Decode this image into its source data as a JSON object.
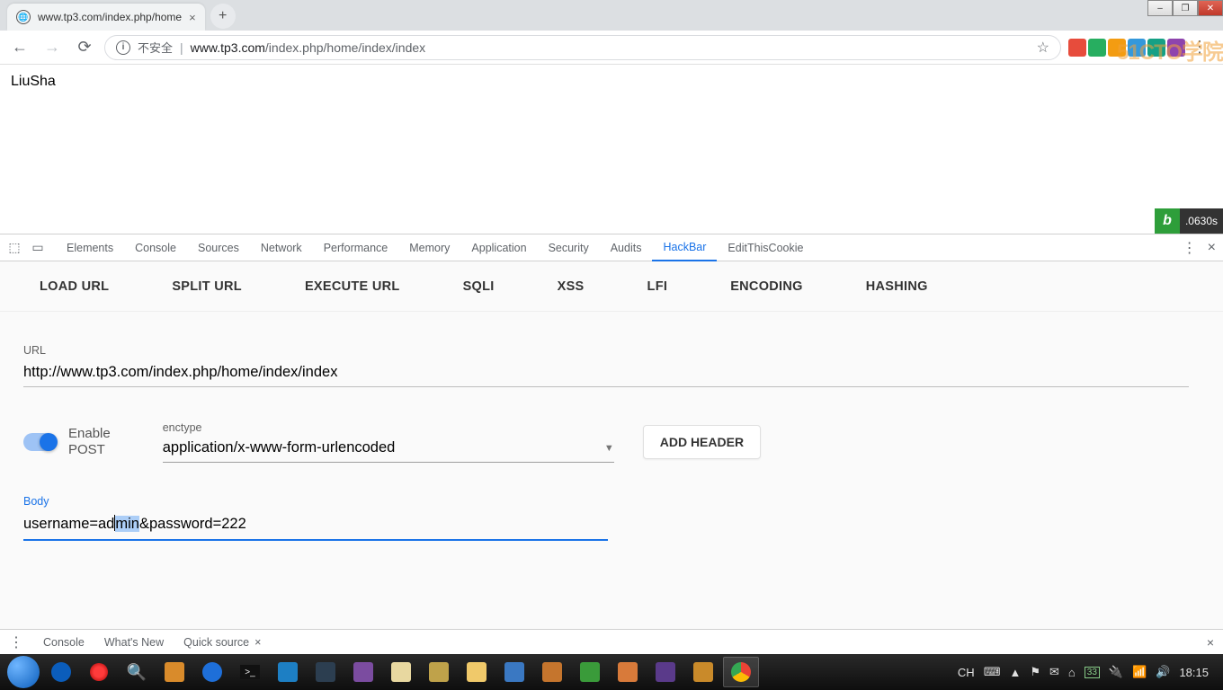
{
  "window": {
    "minimize": "–",
    "maximize": "❐",
    "close": "✕"
  },
  "tab": {
    "title": "www.tp3.com/index.php/home"
  },
  "omnibox": {
    "insecure_label": "不安全",
    "host": "www.tp3.com",
    "path": "/index.php/home/index/index"
  },
  "page": {
    "content": "LiuSha"
  },
  "tp_badge": {
    "logo": "b",
    "time": ".0630s"
  },
  "devtools": {
    "tabs": [
      "Elements",
      "Console",
      "Sources",
      "Network",
      "Performance",
      "Memory",
      "Application",
      "Security",
      "Audits",
      "HackBar",
      "EditThisCookie"
    ],
    "active_tab": "HackBar",
    "drawer": {
      "items": [
        "Console",
        "What's New",
        "Quick source"
      ]
    }
  },
  "hackbar": {
    "menu": [
      "LOAD URL",
      "SPLIT URL",
      "EXECUTE URL",
      "SQLI",
      "XSS",
      "LFI",
      "ENCODING",
      "HASHING"
    ],
    "url_label": "URL",
    "url_value": "http://www.tp3.com/index.php/home/index/index",
    "enable_post_label_1": "Enable",
    "enable_post_label_2": "POST",
    "enctype_label": "enctype",
    "enctype_value": "application/x-www-form-urlencoded",
    "add_header": "ADD HEADER",
    "body_label": "Body",
    "body_value_pre": "username=ad",
    "body_value_sel": "min",
    "body_value_post": "&password=222"
  },
  "tray": {
    "lang": "CH",
    "battery_text": "33",
    "time": "18:15"
  },
  "watermark": "51CTO学院"
}
